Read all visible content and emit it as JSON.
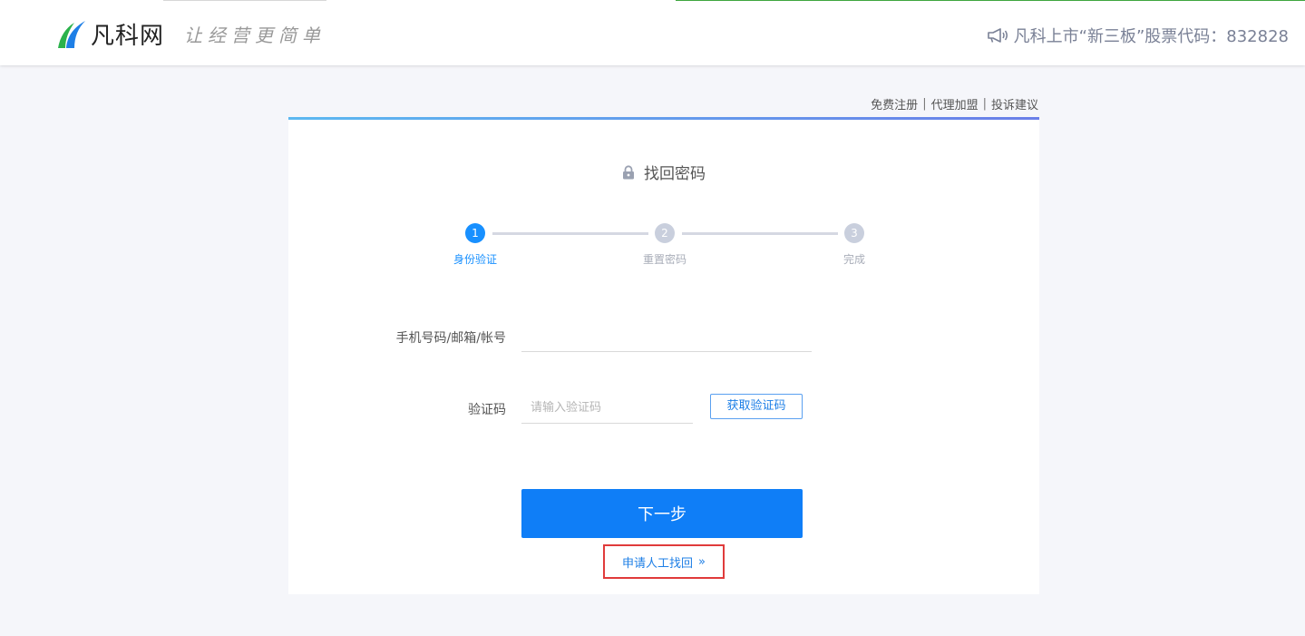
{
  "header": {
    "brand_name": "凡科网",
    "slogan": "让经营更简单",
    "stock_text": "凡科上市“新三板”股票代码：832828",
    "colors": {
      "logo_green": "#2bb24c",
      "logo_blue": "#1e7fe6"
    }
  },
  "top_links": {
    "register": "免费注册",
    "agent": "代理加盟",
    "complaint": "投诉建议",
    "separator": "|"
  },
  "card": {
    "title": "找回密码",
    "lock_icon": "lock-icon",
    "steps": [
      {
        "number": "1",
        "label": "身份验证",
        "state": "active"
      },
      {
        "number": "2",
        "label": "重置密码",
        "state": "todo"
      },
      {
        "number": "3",
        "label": "完成",
        "state": "todo"
      }
    ],
    "form": {
      "account_label": "手机号码/邮箱/帐号",
      "account_value": "",
      "code_label": "验证码",
      "code_placeholder": "请输入验证码",
      "get_code_button": "获取验证码"
    },
    "next_button": "下一步",
    "manual_link": "申请人工找回",
    "manual_arrow": "»"
  },
  "colors": {
    "primary": "#0f7ef7",
    "highlight_border": "#e03b3b",
    "page_bg": "#f5f6fa"
  }
}
